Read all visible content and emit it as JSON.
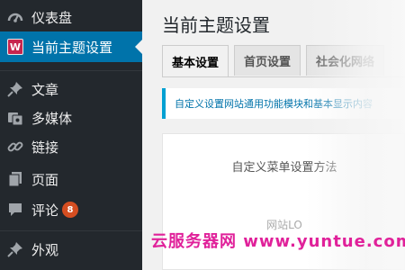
{
  "sidebar": {
    "items": [
      {
        "label": "仪表盘",
        "icon": "dashboard-icon"
      },
      {
        "label": "当前主题设置",
        "icon": "theme-logo-icon",
        "logo_text": "W"
      },
      {
        "label": "文章",
        "icon": "pin-icon"
      },
      {
        "label": "多媒体",
        "icon": "media-icon"
      },
      {
        "label": "链接",
        "icon": "link-icon"
      },
      {
        "label": "页面",
        "icon": "page-icon"
      },
      {
        "label": "评论",
        "icon": "comment-icon",
        "badge": "8"
      },
      {
        "label": "外观",
        "icon": "appearance-icon"
      }
    ],
    "active_color": "#0073aa",
    "background": "#23282d"
  },
  "main": {
    "title": "当前主题设置",
    "tabs": [
      {
        "label": "基本设置",
        "active": true
      },
      {
        "label": "首页设置",
        "active": false
      },
      {
        "label": "社会化网络",
        "active": false
      }
    ],
    "notice": "自定义设置网站通用功能模块和基本显示内容",
    "panel_title": "自定义菜单设置方法",
    "panel_sub": "网站LO"
  },
  "watermark": "云服务器网 www.yuntue.com"
}
